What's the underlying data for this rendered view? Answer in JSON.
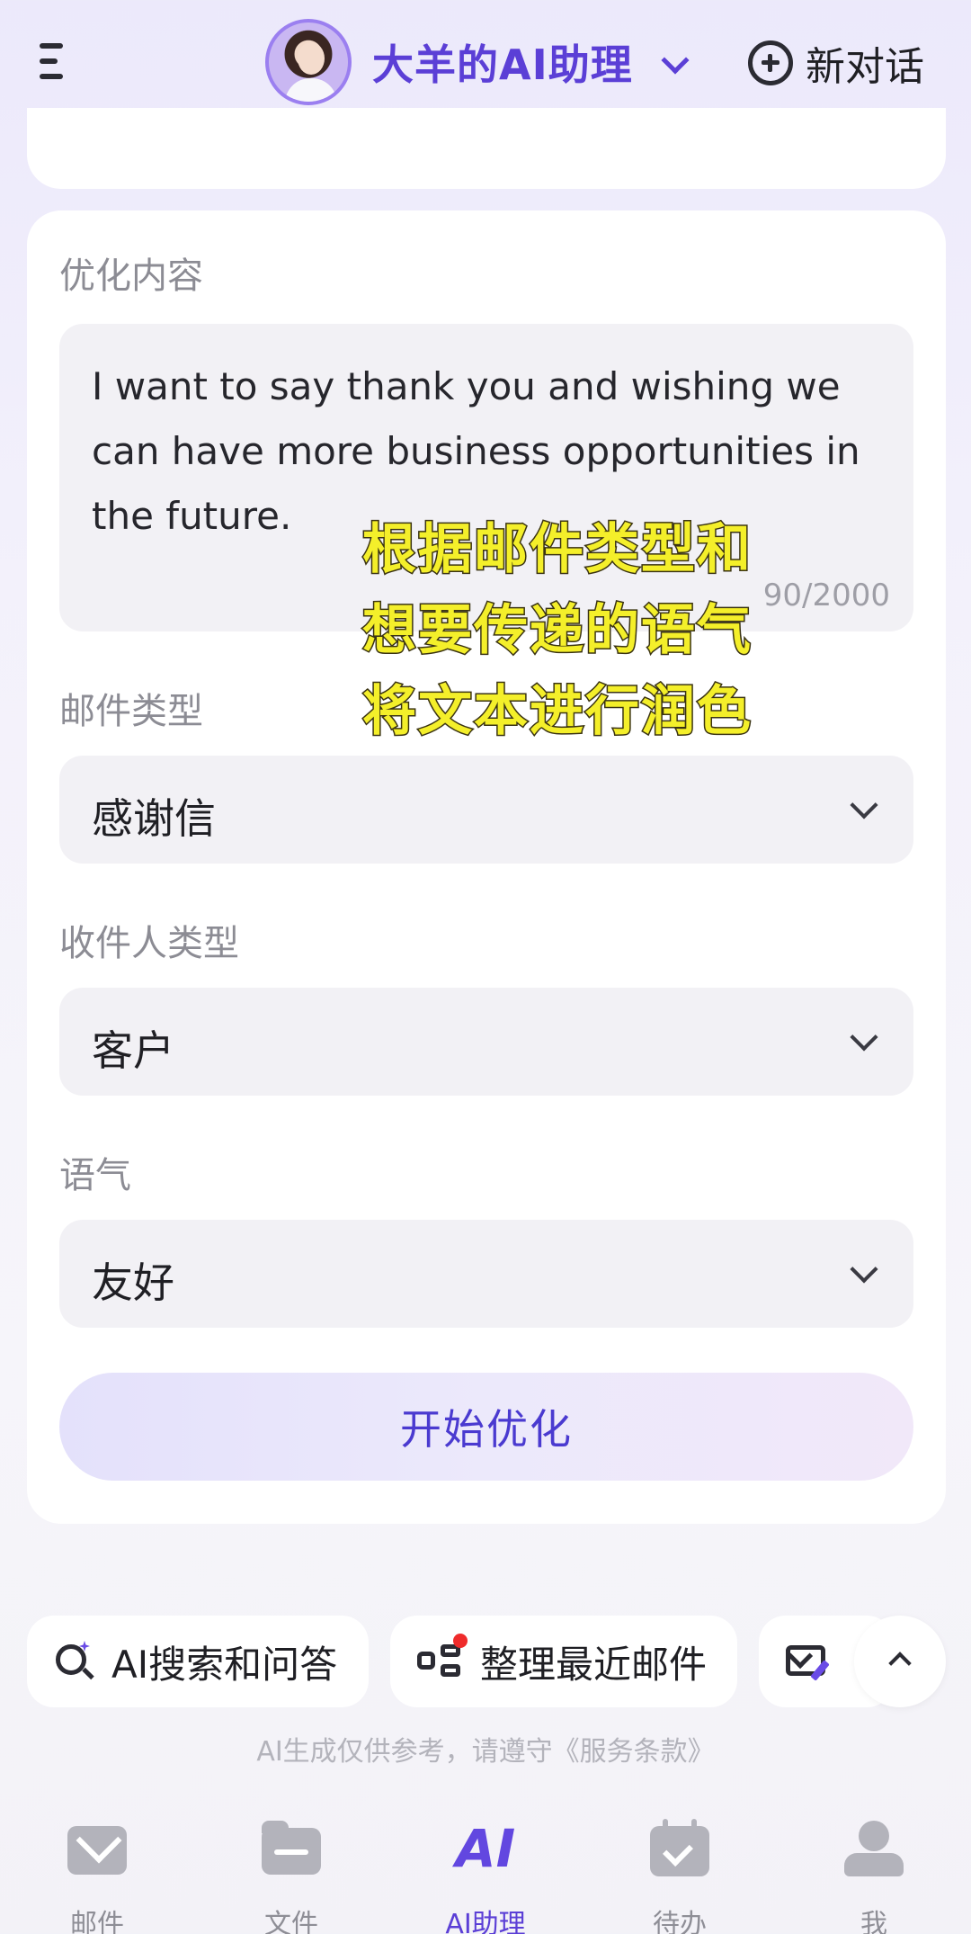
{
  "header": {
    "title": "大羊的AI助理",
    "new_chat_label": "新对话"
  },
  "form": {
    "content_label": "优化内容",
    "content_value": "I want to say thank you and wishing we can have more business opportunities in the future.",
    "content_counter": "90/2000",
    "email_type_label": "邮件类型",
    "email_type_value": "感谢信",
    "recipient_type_label": "收件人类型",
    "recipient_type_value": "客户",
    "tone_label": "语气",
    "tone_value": "友好",
    "submit_label": "开始优化"
  },
  "overlay": {
    "line1": "根据邮件类型和",
    "line2": "想要传递的语气",
    "line3": "将文本进行润色"
  },
  "chips": {
    "search_label": "AI搜索和问答",
    "organize_label": "整理最近邮件"
  },
  "disclaimer": "AI生成仅供参考，请遵守《服务条款》",
  "nav": {
    "mail": "邮件",
    "files": "文件",
    "ai_icon_text": "AI",
    "ai": "AI助理",
    "todo": "待办",
    "me": "我"
  },
  "colors": {
    "accent": "#5b3fd6",
    "overlay_text": "#f4ef2a",
    "badge": "#ef2b2b"
  }
}
